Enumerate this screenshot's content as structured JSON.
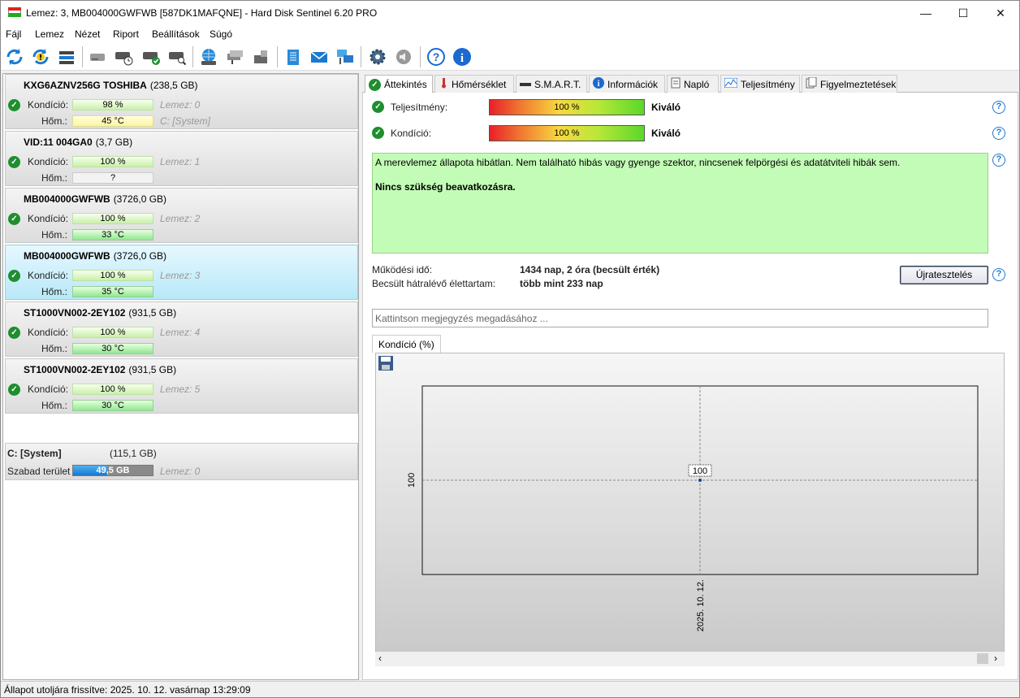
{
  "window": {
    "title": "Lemez: 3, MB004000GWFWB [587DK1MAFQNE]  -  Hard Disk Sentinel 6.20 PRO",
    "min_glyph": "—",
    "max_glyph": "☐",
    "close_glyph": "✕"
  },
  "menu": [
    "Fájl",
    "Lemez",
    "Nézet",
    "Riport",
    "Beállítások",
    "Súgó"
  ],
  "toolbar": {
    "icons": [
      "refresh-icon",
      "refresh-warning-icon",
      "disk-list-icon",
      "disk-icon",
      "disk-schedule-icon",
      "disk-check-icon",
      "disk-search-icon",
      "globe-network-icon",
      "network-disk-icon",
      "external-disk-icon",
      "report-icon",
      "email-icon",
      "network-share-icon",
      "settings-gear-icon",
      "speaker-icon",
      "help-icon",
      "info-icon"
    ]
  },
  "disks": [
    {
      "name": "KXG6AZNV256G TOSHIBA",
      "size": "(238,5 GB)",
      "condition_label": "Kondíció:",
      "condition": "98 %",
      "condition_value": 0.98,
      "temp_label": "Hőm.:",
      "temp": "45 °C",
      "temp_style": "yellow",
      "disk_index": "Lemez: 0",
      "extra": "C: [System]"
    },
    {
      "name": "VID:11  004GA0",
      "size": "(3,7 GB)",
      "condition_label": "Kondíció:",
      "condition": "100 %",
      "condition_value": 1.0,
      "temp_label": "Hőm.:",
      "temp": "?",
      "temp_style": "gray",
      "disk_index": "Lemez: 1",
      "extra": ""
    },
    {
      "name": "MB004000GWFWB",
      "size": "(3726,0 GB)",
      "condition_label": "Kondíció:",
      "condition": "100 %",
      "condition_value": 1.0,
      "temp_label": "Hőm.:",
      "temp": "33 °C",
      "temp_style": "green",
      "disk_index": "Lemez: 2",
      "extra": ""
    },
    {
      "name": "MB004000GWFWB",
      "size": "(3726,0 GB)",
      "condition_label": "Kondíció:",
      "condition": "100 %",
      "condition_value": 1.0,
      "temp_label": "Hőm.:",
      "temp": "35 °C",
      "temp_style": "green",
      "disk_index": "Lemez: 3",
      "extra": ""
    },
    {
      "name": "ST1000VN002-2EY102",
      "size": "(931,5 GB)",
      "condition_label": "Kondíció:",
      "condition": "100 %",
      "condition_value": 1.0,
      "temp_label": "Hőm.:",
      "temp": "30 °C",
      "temp_style": "green",
      "disk_index": "Lemez: 4",
      "extra": ""
    },
    {
      "name": "ST1000VN002-2EY102",
      "size": "(931,5 GB)",
      "condition_label": "Kondíció:",
      "condition": "100 %",
      "condition_value": 1.0,
      "temp_label": "Hőm.:",
      "temp": "30 °C",
      "temp_style": "green",
      "disk_index": "Lemez: 5",
      "extra": ""
    }
  ],
  "volume": {
    "name": "C: [System]",
    "size": "(115,1 GB)",
    "free_label": "Szabad terület",
    "free": "49,5 GB",
    "free_fraction": 0.43,
    "disk_index": "Lemez: 0"
  },
  "tabs": [
    {
      "label": "Áttekintés",
      "icon": "check-icon"
    },
    {
      "label": "Hőmérséklet",
      "icon": "thermometer-icon"
    },
    {
      "label": "S.M.A.R.T.",
      "icon": "smart-icon"
    },
    {
      "label": "Információk",
      "icon": "info-icon"
    },
    {
      "label": "Napló",
      "icon": "log-icon"
    },
    {
      "label": "Teljesítmény",
      "icon": "performance-icon"
    },
    {
      "label": "Figyelmeztetések",
      "icon": "alerts-icon"
    }
  ],
  "overview": {
    "perf_label": "Teljesítmény:",
    "perf_value": "100 %",
    "perf_rating": "Kiváló",
    "cond_label": "Kondíció:",
    "cond_value": "100 %",
    "cond_rating": "Kiváló",
    "status_line1": "A merevlemez állapota hibátlan. Nem található hibás vagy gyenge szektor, nincsenek felpörgési és adatátviteli hibák sem.",
    "status_line2": "Nincs szükség beavatkozásra.",
    "uptime_label": "Működési idő:",
    "uptime_value": "1434 nap, 2 óra (becsült érték)",
    "lifetime_label": "Becsült hátralévő élettartam:",
    "lifetime_value": "több mint 233 nap",
    "retest_button": "Újratesztelés",
    "note_placeholder": "Kattintson megjegyzés megadásához ...",
    "subtab": "Kondíció  (%)"
  },
  "chart_data": {
    "type": "line",
    "title": "Kondíció  (%)",
    "x": [
      "2025. 10. 12."
    ],
    "series": [
      {
        "values": [
          100
        ]
      }
    ],
    "point_labels": [
      "100"
    ],
    "ytick_labels": [
      "100"
    ],
    "xtick_labels": [
      "2025. 10. 12."
    ],
    "grid": true
  },
  "statusbar": "Állapot utoljára frissítve: 2025. 10. 12. vasárnap 13:29:09"
}
